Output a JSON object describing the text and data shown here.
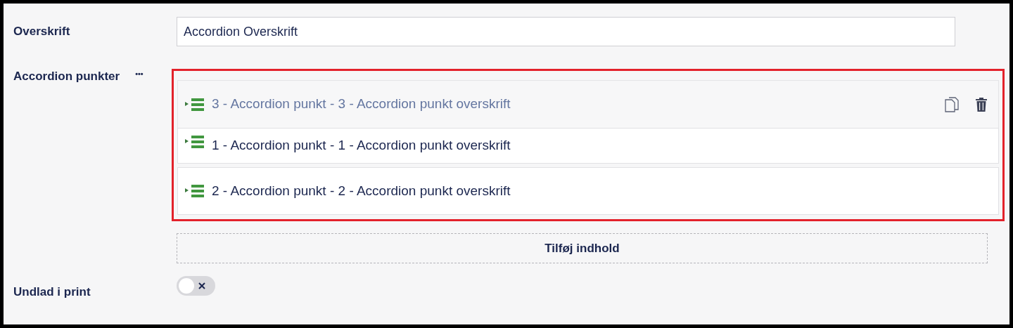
{
  "fields": [
    {
      "kind": "text",
      "label": "Overskrift",
      "value": "Accordion Overskrift"
    },
    {
      "kind": "blocks",
      "label": "Accordion punkter",
      "menu": "•••",
      "items": [
        {
          "title": "3 - Accordion punkt - 3 - Accordion punkt overskrift",
          "dragging": true
        },
        {
          "title": "1 - Accordion punkt - 1 - Accordion punkt overskrift",
          "dragging": false
        },
        {
          "title": "2 - Accordion punkt - 2 - Accordion punkt overskrift",
          "dragging": false
        }
      ],
      "add_button": "Tilføj indhold"
    },
    {
      "kind": "toggle",
      "label": "Undlad i print",
      "on": false
    }
  ]
}
